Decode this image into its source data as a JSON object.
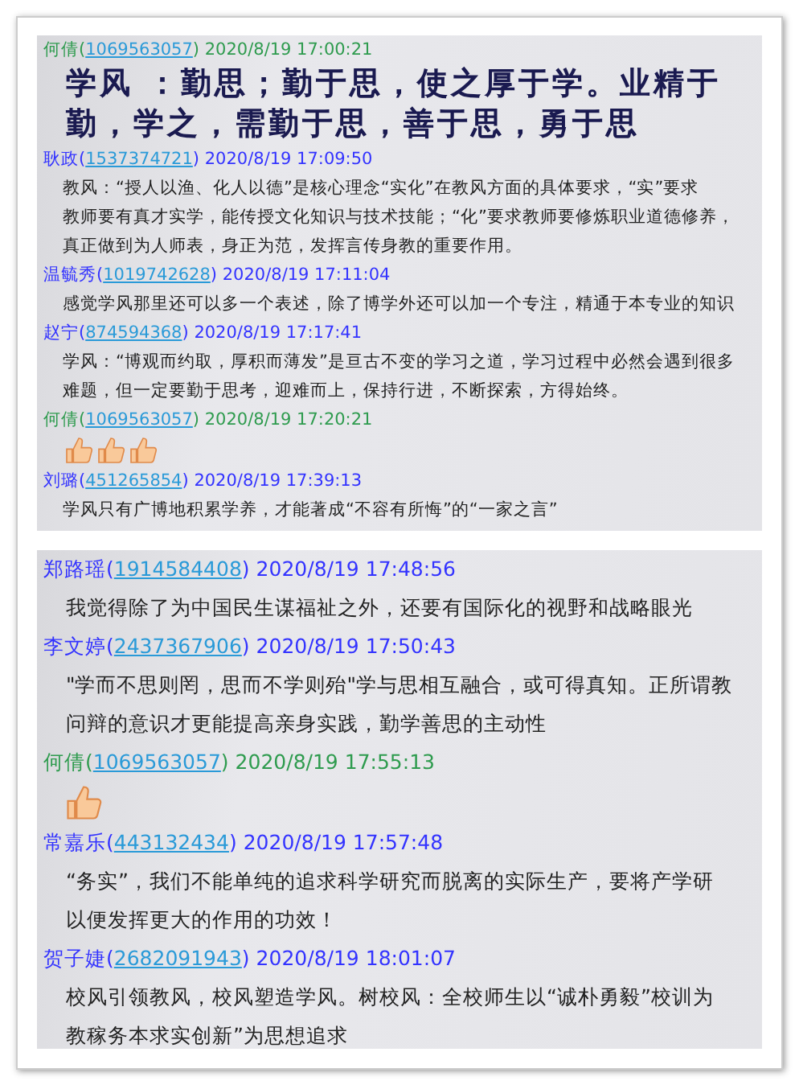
{
  "panels": [
    {
      "messages": [
        {
          "kind": "large",
          "name": "何倩",
          "qq_open": "(",
          "qq": "1069563057",
          "qq_close": ")",
          "time": "2020/8/19 17:00:21",
          "color": "#2e9b4e",
          "lines": [
            "学风 ：勤思；勤于思，使之厚于学。业精于",
            "勤，学之，需勤于思，善于思，勇于思"
          ]
        },
        {
          "kind": "text",
          "name": "耿政",
          "qq_open": "(",
          "qq": "1537374721",
          "qq_close": ")",
          "time": "2020/8/19 17:09:50",
          "color": "#3333ff",
          "lines": [
            "教风：“授人以渔、化人以德”是核心理念“实化”在教风方面的具体要求，“实”要求",
            "教师要有真才实学，能传授文化知识与技术技能；“化”要求教师要修炼职业道德修养，",
            "真正做到为人师表，身正为范，发挥言传身教的重要作用。"
          ]
        },
        {
          "kind": "text",
          "name": "温毓秀",
          "qq_open": "(",
          "qq": "1019742628",
          "qq_close": ")",
          "time": "2020/8/19 17:11:04",
          "color": "#3333ff",
          "lines": [
            "感觉学风那里还可以多一个表述，除了博学外还可以加一个专注，精通于本专业的知识"
          ]
        },
        {
          "kind": "text",
          "name": "赵宁",
          "qq_open": "(",
          "qq": "874594368",
          "qq_close": ")",
          "time": "2020/8/19 17:17:41",
          "color": "#3333ff",
          "lines": [
            "学风：“博观而约取，厚积而薄发”是亘古不变的学习之道，学习过程中必然会遇到很多",
            "难题，但一定要勤于思考，迎难而上，保持行进，不断探索，方得始终。"
          ]
        },
        {
          "kind": "emoji",
          "name": "何倩",
          "qq_open": "(",
          "qq": "1069563057",
          "qq_close": ")",
          "time": "2020/8/19 17:20:21",
          "color": "#2e9b4e",
          "stickers": [
            {
              "kind": "thumbs-up"
            },
            {
              "kind": "thumbs-up"
            },
            {
              "kind": "thumbs-up"
            }
          ]
        },
        {
          "kind": "text",
          "name": "刘璐",
          "qq_open": "(",
          "qq": "451265854",
          "qq_close": ")",
          "time": "2020/8/19 17:39:13",
          "color": "#3333ff",
          "lines": [
            "学风只有广博地积累学养，才能著成“不容有所悔”的“一家之言”"
          ]
        }
      ]
    },
    {
      "messages": [
        {
          "kind": "text",
          "name": "郑路瑶",
          "qq_open": "(",
          "qq": "1914584408",
          "qq_close": ")",
          "time": "2020/8/19 17:48:56",
          "color": "#3333ff",
          "lines": [
            "我觉得除了为中国民生谋福祉之外，还要有国际化的视野和战略眼光"
          ]
        },
        {
          "kind": "text",
          "name": "李文婷",
          "qq_open": "(",
          "qq": "2437367906",
          "qq_close": ")",
          "time": "2020/8/19 17:50:43",
          "color": "#3333ff",
          "lines": [
            "\"学而不思则罔，思而不学则殆\"学与思相互融合，或可得真知。正所谓教",
            "问辩的意识才更能提高亲身实践，勤学善思的主动性"
          ]
        },
        {
          "kind": "emoji",
          "name": "何倩",
          "qq_open": "(",
          "qq": "1069563057",
          "qq_close": ")",
          "time": "2020/8/19 17:55:13",
          "color": "#2e9b4e",
          "stickers": [
            {
              "kind": "thumbs-up"
            }
          ]
        },
        {
          "kind": "text",
          "name": "常嘉乐",
          "qq_open": "(",
          "qq": "443132434",
          "qq_close": ")",
          "time": "2020/8/19 17:57:48",
          "color": "#3333ff",
          "lines": [
            "“务实”，我们不能单纯的追求科学研究而脱离的实际生产，要将产学研",
            "以便发挥更大的作用的功效！"
          ]
        },
        {
          "kind": "text",
          "name": "贺子婕",
          "qq_open": "(",
          "qq": "2682091943",
          "qq_close": ")",
          "time": "2020/8/19 18:01:07",
          "color": "#3333ff",
          "lines": [
            "校风引领教风，校风塑造学风。树校风：全校师生以“诚朴勇毅”校训为",
            "教稼务本求实创新”为思想追求"
          ]
        }
      ]
    }
  ]
}
